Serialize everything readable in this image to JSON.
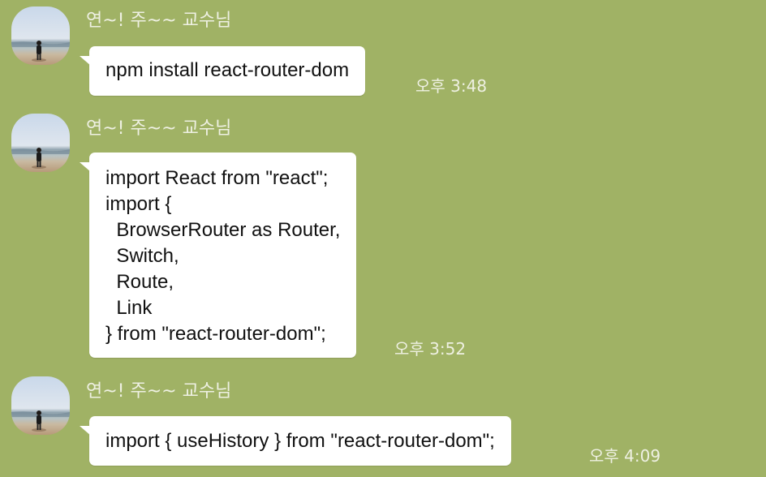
{
  "messages": [
    {
      "sender": "연~! 주~~ 교수님",
      "text": "npm install react-router-dom",
      "time": "오후 3:48"
    },
    {
      "sender": "연~! 주~~ 교수님",
      "text": "import React from \"react\";\nimport {\n  BrowserRouter as Router,\n  Switch,\n  Route,\n  Link\n} from \"react-router-dom\";",
      "time": "오후 3:52"
    },
    {
      "sender": "연~! 주~~ 교수님",
      "text": "import { useHistory } from \"react-router-dom\";",
      "time": "오후 4:09"
    }
  ]
}
